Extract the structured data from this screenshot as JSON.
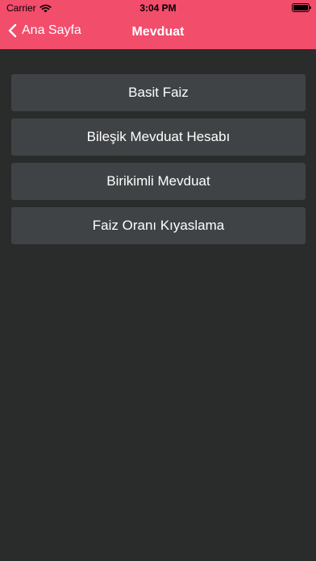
{
  "status_bar": {
    "carrier": "Carrier",
    "time": "3:04 PM"
  },
  "nav": {
    "back_label": "Ana Sayfa",
    "title": "Mevduat"
  },
  "menu": {
    "items": [
      {
        "label": "Basit Faiz"
      },
      {
        "label": "Bileşik Mevduat Hesabı"
      },
      {
        "label": "Birikimli Mevduat"
      },
      {
        "label": "Faiz Oranı Kıyaslama"
      }
    ]
  },
  "colors": {
    "header": "#f24d6b",
    "background": "#2a2c2c",
    "button": "#404345"
  }
}
